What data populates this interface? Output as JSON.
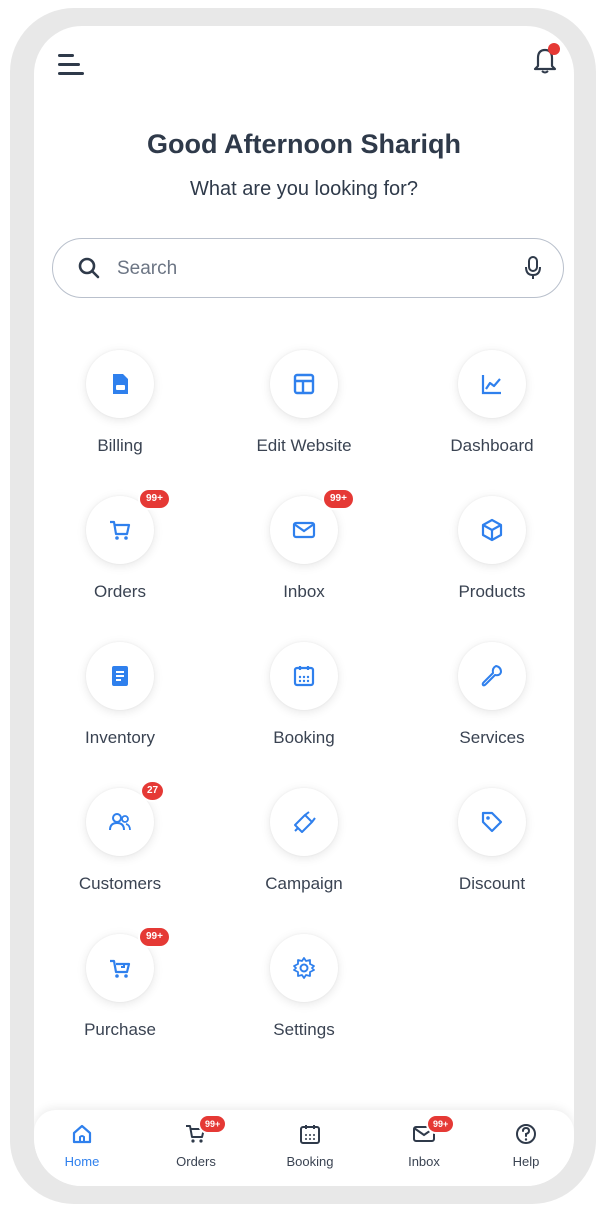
{
  "header": {
    "greeting": "Good Afternoon Shariqh",
    "subtitle": "What are you looking for?"
  },
  "search": {
    "placeholder": "Search",
    "value": ""
  },
  "grid": {
    "billing": {
      "label": "Billing",
      "icon": "bill-icon"
    },
    "edit_website": {
      "label": "Edit Website",
      "icon": "layout-icon"
    },
    "dashboard": {
      "label": "Dashboard",
      "icon": "chart-icon"
    },
    "orders": {
      "label": "Orders",
      "icon": "cart-icon",
      "badge": "99+"
    },
    "inbox": {
      "label": "Inbox",
      "icon": "mail-icon",
      "badge": "99+"
    },
    "products": {
      "label": "Products",
      "icon": "box-icon"
    },
    "inventory": {
      "label": "Inventory",
      "icon": "clipboard-icon"
    },
    "booking": {
      "label": "Booking",
      "icon": "calendar-icon"
    },
    "services": {
      "label": "Services",
      "icon": "wrench-icon"
    },
    "customers": {
      "label": "Customers",
      "icon": "users-icon",
      "badge": "27"
    },
    "campaign": {
      "label": "Campaign",
      "icon": "megaphone-icon"
    },
    "discount": {
      "label": "Discount",
      "icon": "tag-icon"
    },
    "purchase": {
      "label": "Purchase",
      "icon": "purchase-cart-icon",
      "badge": "99+"
    },
    "settings": {
      "label": "Settings",
      "icon": "gear-icon"
    }
  },
  "bottom_nav": {
    "home": {
      "label": "Home",
      "active": true
    },
    "orders": {
      "label": "Orders",
      "badge": "99+"
    },
    "booking": {
      "label": "Booking"
    },
    "inbox": {
      "label": "Inbox",
      "badge": "99+"
    },
    "help": {
      "label": "Help"
    }
  },
  "colors": {
    "accent": "#2f80ed",
    "badge": "#e53935",
    "text": "#2f3a4a"
  }
}
